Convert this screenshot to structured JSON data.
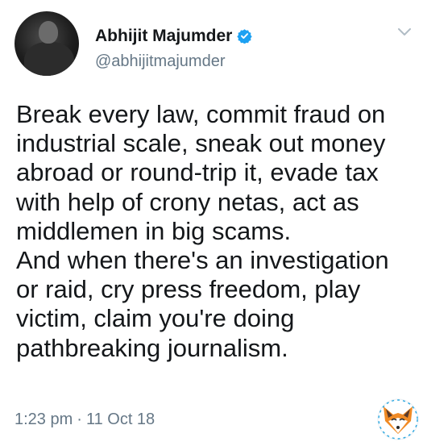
{
  "author": {
    "display_name": "Abhijit Majumder",
    "handle": "@abhijitmajumder",
    "verified": true,
    "avatar_icon": "profile-photo"
  },
  "tweet": {
    "text": "Break every law, commit fraud on\nindustrial scale, sneak out money\nabroad or round-trip it, evade tax\nwith help of crony netas, act as\nmiddlemen in big scams.\nAnd when there's an investigation\nor raid, cry press freedom, play\nvictim, claim you're doing\npathbreaking journalism.",
    "time": "1:23 pm",
    "separator": "·",
    "date": "11 Oct 18"
  },
  "icons": {
    "verified": "verified-badge-icon",
    "menu": "chevron-down-icon",
    "watermark": "fox-logo-icon"
  },
  "colors": {
    "text_primary": "#14171a",
    "text_secondary": "#657786",
    "verified_blue": "#1da1f2"
  }
}
